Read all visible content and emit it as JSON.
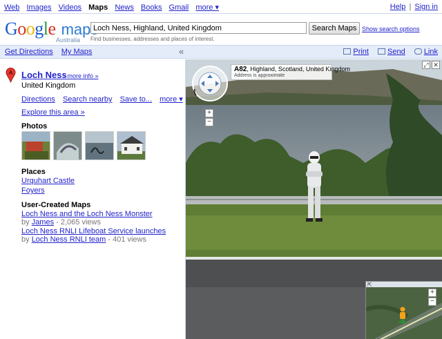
{
  "topnav": {
    "links": [
      "Web",
      "Images",
      "Videos",
      "Maps",
      "News",
      "Books",
      "Gmail",
      "more ▾"
    ],
    "current": "Maps",
    "help": "Help",
    "sign_in": "Sign in"
  },
  "header": {
    "logo_google": "Google",
    "logo_maps": "maps",
    "logo_region": "Australia",
    "search_value": "Loch Ness, Highland, United Kingdom",
    "search_button": "Search Maps",
    "show_options": "Show search options",
    "hint": "Find businesses, addresses and places of interest."
  },
  "bar": {
    "get_directions": "Get Directions",
    "my_maps": "My Maps",
    "collapse": "«",
    "print": "Print",
    "send": "Send",
    "link": "Link"
  },
  "place": {
    "marker": "A",
    "title": "Loch Ness",
    "more_info": "- more info »",
    "country": "United Kingdom",
    "actions": [
      "Directions",
      "Search nearby",
      "Save to...",
      "more ▾"
    ],
    "explore": "Explore this area »",
    "photos_heading": "Photos",
    "places_heading": "Places",
    "places": [
      "Urquhart Castle",
      "Foyers"
    ],
    "ucm_heading": "User-Created Maps",
    "maps": [
      {
        "title": "Loch Ness and the Loch Ness Monster",
        "by": "by",
        "author": "James",
        "views": "- 2,065 views"
      },
      {
        "title": "Loch Ness RNLI Lifeboat Service launches",
        "by": "by",
        "author": "Loch Ness RNLI team",
        "views": "- 401 views"
      }
    ]
  },
  "streetview": {
    "road": "A82",
    "location": ", Highland, Scotland, United Kingdom",
    "note": "Address is approximate",
    "zoom_in": "+",
    "zoom_out": "−"
  },
  "colors": {
    "link": "#2222cc",
    "bar_bg": "#e5ecf9",
    "maps_blue": "#2d7ad3",
    "marker_red": "#e8362b"
  }
}
